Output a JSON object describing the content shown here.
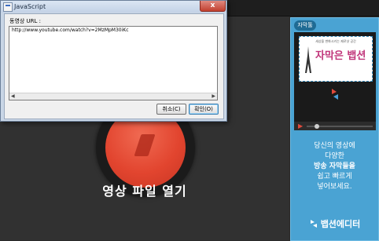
{
  "dialog": {
    "title": "JavaScript",
    "label": "동영상 URL :",
    "url_value": "http://www.youtube.com/watch?v=2MzMpM30iKc",
    "cancel_label": "취소(C)",
    "ok_label": "확인(O)",
    "close_label": "x"
  },
  "main": {
    "open_video_label": "영상 파일 열기"
  },
  "ad": {
    "badge": "자막툴",
    "preview_small": "세상을 변화시키는 제로샷 공간",
    "preview_title": "자막은 뱁션",
    "text_lines": [
      "당신의 영상에",
      "다양한",
      "방송 자막들을",
      "쉽고 빠르게",
      "넣어보세요."
    ],
    "brand": "뱁션에디터"
  },
  "colors": {
    "accent": "#e2452f",
    "ad_background": "#4aa3d3",
    "dialog_frame": "#c9d6e6"
  }
}
